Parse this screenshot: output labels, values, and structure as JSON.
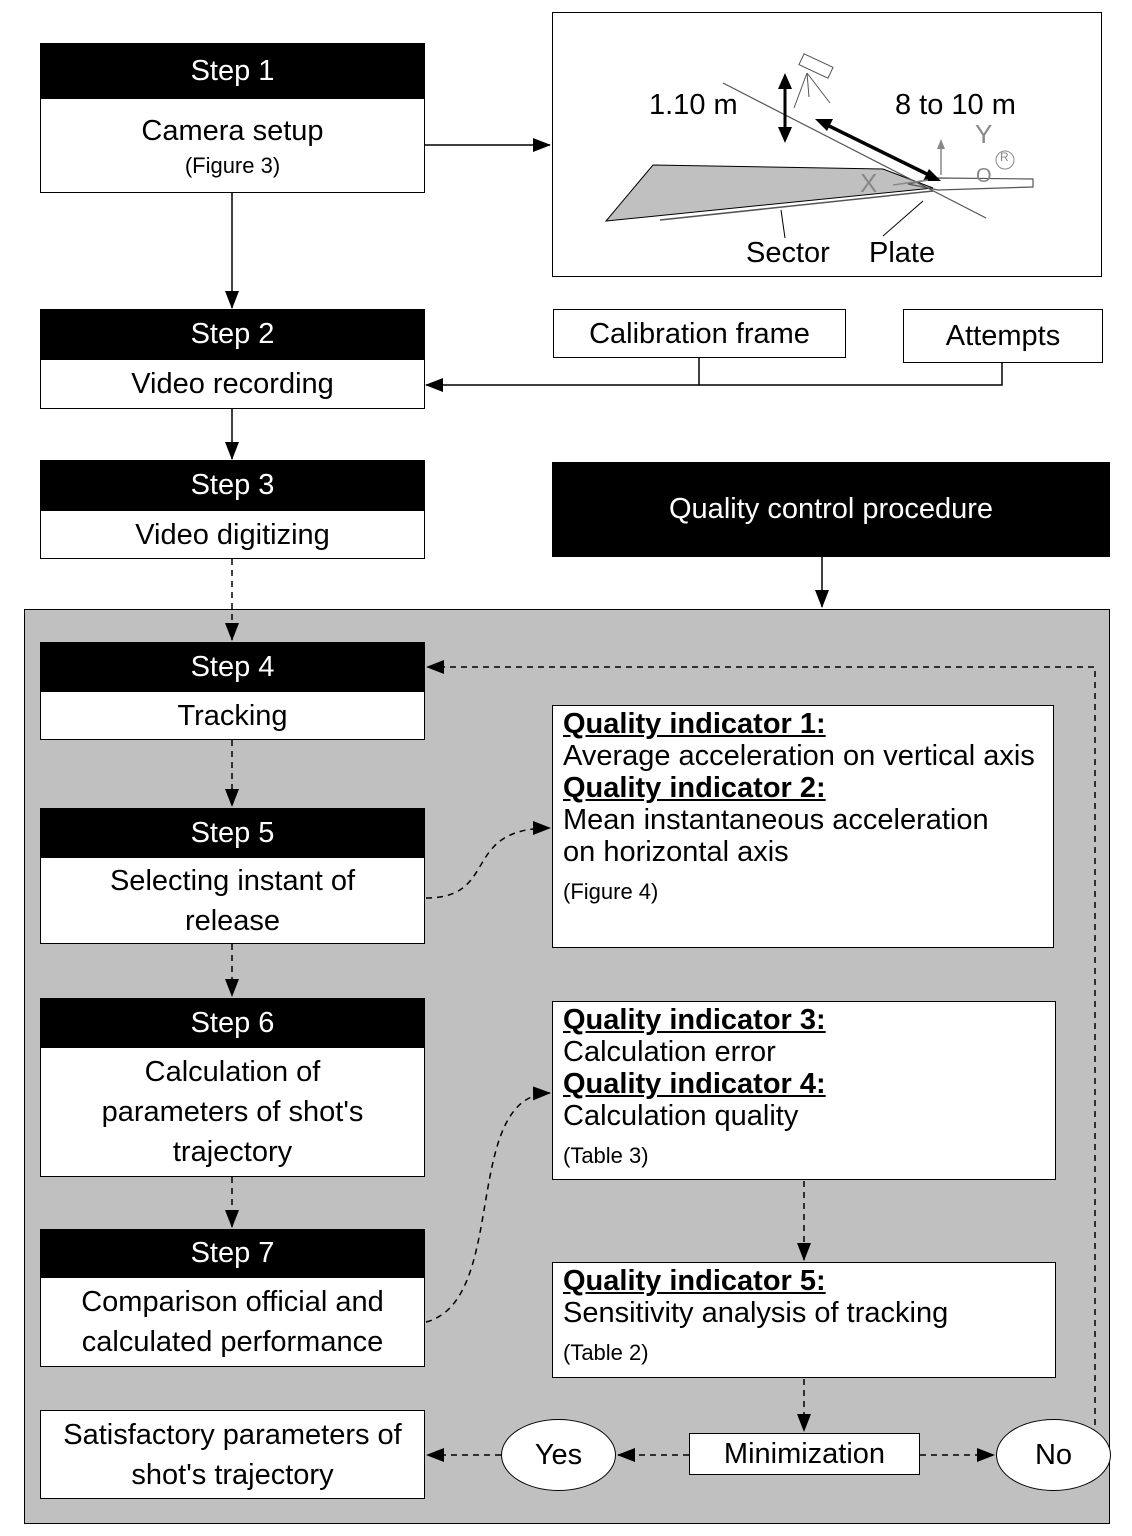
{
  "steps": [
    {
      "label": "Step 1",
      "text": "Camera setup",
      "note": "(Figure 3)"
    },
    {
      "label": "Step 2",
      "text": "Video recording"
    },
    {
      "label": "Step 3",
      "text": "Video digitizing"
    },
    {
      "label": "Step 4",
      "text": "Tracking"
    },
    {
      "label": "Step 5",
      "text": "Selecting instant of release"
    },
    {
      "label": "Step 6",
      "text": "Calculation of parameters of shot's trajectory"
    },
    {
      "label": "Step 7",
      "text": "Comparison official and calculated performance"
    }
  ],
  "figure": {
    "height": "1.10 m",
    "distance": "8 to 10 m",
    "sector": "Sector",
    "plate": "Plate",
    "x_axis": "X",
    "y_axis": "Y",
    "origin": "O",
    "r_mark": "R"
  },
  "inputs": {
    "calibration": "Calibration frame",
    "attempts": "Attempts"
  },
  "qc_title": "Quality control procedure",
  "indicators": [
    {
      "title": "Quality indicator 1:",
      "text": "Average acceleration on vertical axis"
    },
    {
      "title": "Quality indicator 2:",
      "text": "Mean instantaneous acceleration on horizontal axis",
      "note": "(Figure 4)"
    },
    {
      "title": "Quality indicator 3:",
      "text": "Calculation error"
    },
    {
      "title": "Quality indicator 4:",
      "text": "Calculation quality",
      "note": "(Table 3)"
    },
    {
      "title": "Quality indicator 5:",
      "text": "Sensitivity analysis of tracking",
      "note": "(Table 2)"
    }
  ],
  "minimization": "Minimization",
  "yes": "Yes",
  "no": "No",
  "result": "Satisfactory parameters of shot's trajectory",
  "colors": {
    "panel": "#c0c0c0",
    "header": "#000000",
    "axis_gray": "#888888"
  }
}
